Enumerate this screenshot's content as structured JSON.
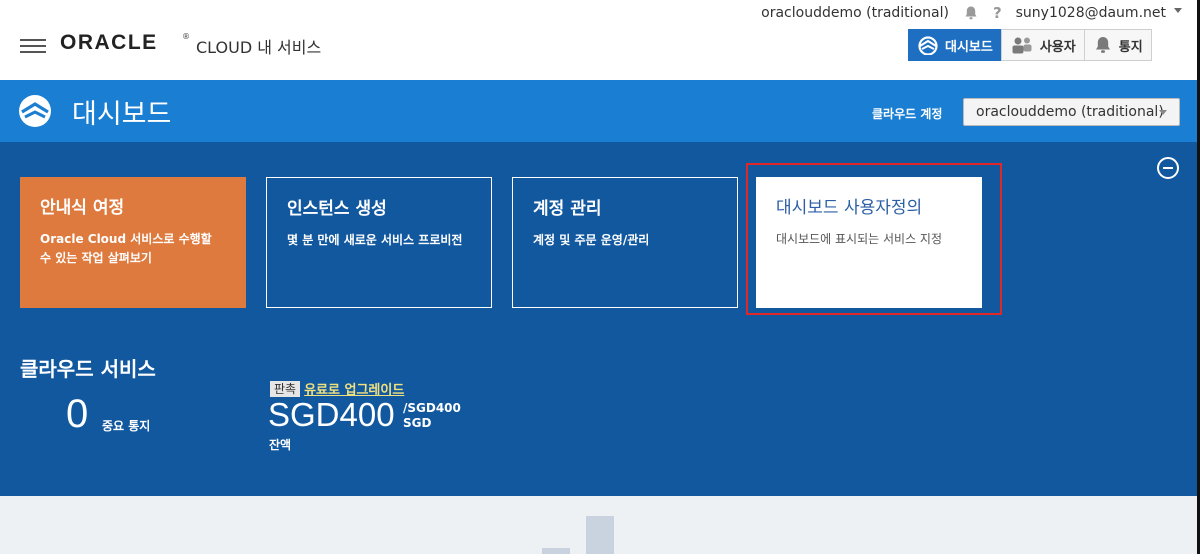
{
  "topbar": {
    "brand": "ORACLE",
    "brand_mark": "®",
    "subtitle": "CLOUD 내 서비스",
    "identity_domain": "oraclouddemo (traditional)",
    "help": "?",
    "user": "suny1028@daum.net",
    "nav": [
      {
        "label": "대시보드",
        "icon": "dashboard-icon",
        "active": true
      },
      {
        "label": "사용자",
        "icon": "users-icon",
        "active": false
      },
      {
        "label": "통지",
        "icon": "bell-icon",
        "active": false
      }
    ]
  },
  "header": {
    "title": "대시보드",
    "account_label": "클라우드 계정",
    "account_value": "oraclouddemo (traditional)"
  },
  "cards": [
    {
      "title": "안내식 여정",
      "desc": "Oracle Cloud 서비스로 수행할 수 있는 작업 살펴보기"
    },
    {
      "title": "인스턴스 생성",
      "desc": "몇 분 만에 새로운 서비스 프로비전"
    },
    {
      "title": "계정 관리",
      "desc": "계정 및 주문 운영/관리"
    },
    {
      "title": "대시보드 사용자정의",
      "desc": "대시보드에 표시되는 서비스 지정"
    }
  ],
  "services": {
    "heading": "클라우드 서비스",
    "count": "0",
    "count_label": "중요 통지",
    "trial_badge": "판촉",
    "upgrade_link": "유료로 업그레이드",
    "balance": "SGD400",
    "balance_total": "/SGD400",
    "balance_currency": "SGD",
    "balance_label": "잔액"
  },
  "colors": {
    "header_blue": "#1a7fd3",
    "panel_blue": "#11589f",
    "orange_card": "#de7a3d",
    "nav_active": "#1e6fc2",
    "highlight_red": "#e02828",
    "upgrade_yellow": "#f1e17e"
  }
}
